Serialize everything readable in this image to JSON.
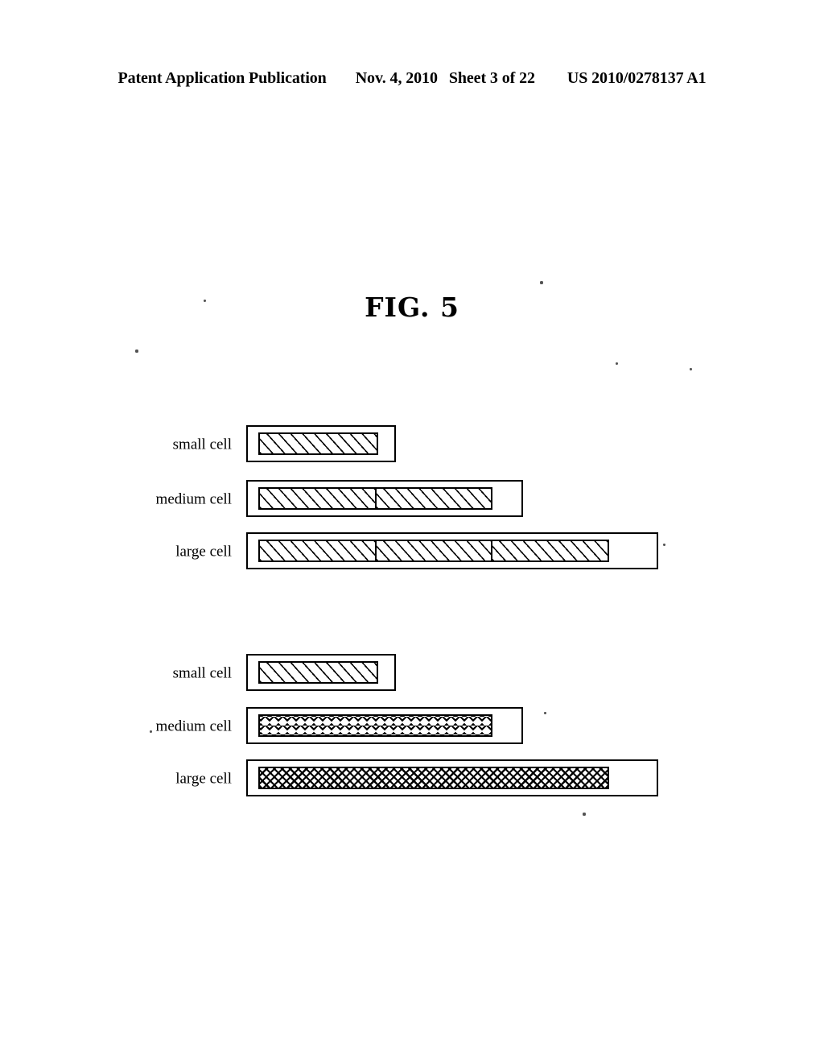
{
  "header": {
    "publication": "Patent Application Publication",
    "date": "Nov. 4, 2010",
    "sheet": "Sheet 3 of 22",
    "patent_number": "US 2010/0278137 A1"
  },
  "figure": {
    "title": "FIG. 5"
  },
  "chart_data": {
    "type": "bar",
    "title": "FIG. 5",
    "xlabel": "",
    "ylabel": "",
    "grid": false,
    "legend": "none",
    "orientation": "horizontal",
    "description": "Two stacked groups of horizontal bar diagrams comparing small, medium and large cell bandwidth/carrier allocations. Each row shows an outer container rectangle with an inner patterned bar; the inner bar of the upper group is divided into equal component segments.",
    "groups": [
      {
        "name": "group-1-segmented-carriers",
        "categories": [
          "small cell",
          "medium cell",
          "large cell"
        ],
        "values": [
          1,
          2,
          3
        ],
        "value_unit": "component carriers",
        "rows": [
          {
            "label": "small cell",
            "segments": 1,
            "pattern": "diagonal-hatch",
            "outer_width": 186,
            "inner_width": 149
          },
          {
            "label": "medium cell",
            "segments": 2,
            "pattern": "diagonal-hatch",
            "outer_width": 344,
            "inner_width": 291
          },
          {
            "label": "large cell",
            "segments": 3,
            "pattern": "diagonal-hatch",
            "outer_width": 512,
            "inner_width": 436
          }
        ]
      },
      {
        "name": "group-2-single-wideband-carriers",
        "categories": [
          "small cell",
          "medium cell",
          "large cell"
        ],
        "values": [
          1,
          1,
          1
        ],
        "value_unit": "single carrier",
        "rows": [
          {
            "label": "small cell",
            "segments": 1,
            "pattern": "diagonal-hatch",
            "outer_width": 186,
            "inner_width": 149
          },
          {
            "label": "medium cell",
            "segments": 1,
            "pattern": "sparse-x-marks",
            "outer_width": 344,
            "inner_width": 291
          },
          {
            "label": "large cell",
            "segments": 1,
            "pattern": "dense-cross-hatch",
            "outer_width": 512,
            "inner_width": 436
          }
        ]
      }
    ]
  },
  "colors": {
    "ink": "#000000",
    "page": "#ffffff"
  }
}
